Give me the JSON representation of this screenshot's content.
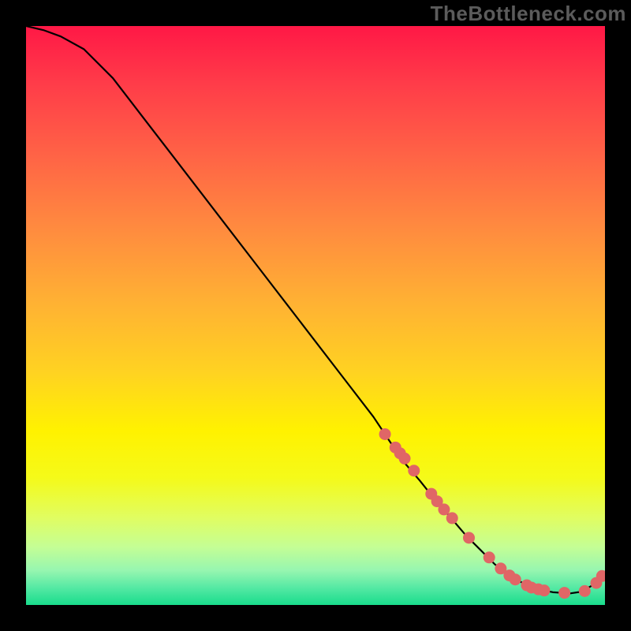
{
  "watermark": "TheBottleneck.com",
  "gradient_stops": [
    {
      "offset": 0.0,
      "color": "#ff1846"
    },
    {
      "offset": 0.1,
      "color": "#ff3c49"
    },
    {
      "offset": 0.22,
      "color": "#ff6246"
    },
    {
      "offset": 0.35,
      "color": "#ff8b3f"
    },
    {
      "offset": 0.48,
      "color": "#ffb233"
    },
    {
      "offset": 0.6,
      "color": "#ffd321"
    },
    {
      "offset": 0.7,
      "color": "#fff200"
    },
    {
      "offset": 0.78,
      "color": "#f5fa19"
    },
    {
      "offset": 0.85,
      "color": "#e0fd62"
    },
    {
      "offset": 0.9,
      "color": "#c4fe95"
    },
    {
      "offset": 0.94,
      "color": "#97f6b0"
    },
    {
      "offset": 0.97,
      "color": "#55e9a4"
    },
    {
      "offset": 1.0,
      "color": "#19dc8c"
    }
  ],
  "chart_data": {
    "type": "line",
    "title": "",
    "xlabel": "",
    "ylabel": "",
    "xlim": [
      0,
      100
    ],
    "ylim": [
      0,
      100
    ],
    "series": [
      {
        "name": "curve",
        "x": [
          0,
          3,
          6,
          10,
          15,
          20,
          25,
          30,
          35,
          40,
          45,
          50,
          55,
          60,
          63,
          65,
          68,
          70,
          73,
          76,
          79,
          81,
          83,
          85,
          87,
          89,
          91,
          94,
          96,
          98,
          100
        ],
        "y": [
          100,
          99.3,
          98.2,
          96.0,
          91.0,
          84.5,
          78.0,
          71.5,
          65.0,
          58.5,
          52.0,
          45.5,
          39.0,
          32.5,
          28.0,
          25.0,
          21.5,
          19.0,
          15.5,
          12.0,
          9.0,
          7.0,
          5.5,
          4.2,
          3.2,
          2.6,
          2.2,
          2.0,
          2.3,
          3.5,
          5.5
        ]
      }
    ],
    "markers": {
      "name": "dots",
      "x": [
        62,
        63.8,
        64.6,
        65.4,
        67.0,
        70.0,
        71.0,
        72.2,
        73.6,
        76.5,
        80.0,
        82.0,
        83.5,
        84.5,
        86.5,
        87.3,
        88.5,
        89.5,
        93.0,
        96.5,
        98.5,
        99.5
      ],
      "y": [
        29.5,
        27.2,
        26.2,
        25.3,
        23.2,
        19.2,
        17.9,
        16.5,
        15.0,
        11.6,
        8.2,
        6.3,
        5.1,
        4.4,
        3.4,
        3.0,
        2.7,
        2.5,
        2.1,
        2.4,
        3.8,
        5.0
      ]
    }
  }
}
